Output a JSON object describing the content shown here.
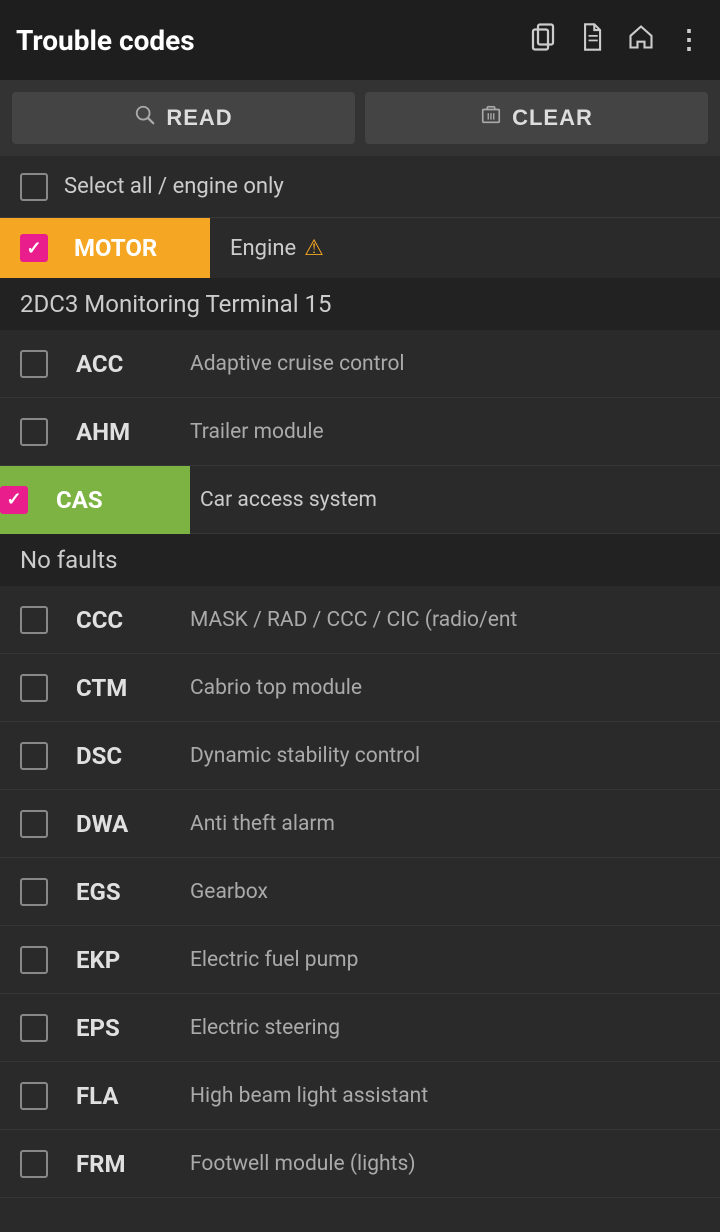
{
  "header": {
    "title": "Trouble codes",
    "icons": [
      "copy",
      "document",
      "home",
      "more"
    ]
  },
  "toolbar": {
    "read_label": "READ",
    "clear_label": "CLEAR"
  },
  "select_all": {
    "label": "Select all / engine only",
    "checked": false
  },
  "motor_module": {
    "badge": "MOTOR",
    "description": "Engine",
    "checked": true,
    "has_warning": true
  },
  "sub_header": "2DC3 Monitoring Terminal 15",
  "items": [
    {
      "code": "ACC",
      "desc": "Adaptive cruise control",
      "checked": false,
      "highlighted": false
    },
    {
      "code": "AHM",
      "desc": "Trailer module",
      "checked": false,
      "highlighted": false
    },
    {
      "code": "CAS",
      "desc": "Car access system",
      "checked": true,
      "highlighted": true
    },
    {
      "no_faults": "No faults"
    },
    {
      "code": "CCC",
      "desc": "MASK / RAD / CCC / CIC (radio/ent",
      "checked": false,
      "highlighted": false
    },
    {
      "code": "CTM",
      "desc": "Cabrio top module",
      "checked": false,
      "highlighted": false
    },
    {
      "code": "DSC",
      "desc": "Dynamic stability control",
      "checked": false,
      "highlighted": false
    },
    {
      "code": "DWA",
      "desc": "Anti theft alarm",
      "checked": false,
      "highlighted": false
    },
    {
      "code": "EGS",
      "desc": "Gearbox",
      "checked": false,
      "highlighted": false
    },
    {
      "code": "EKP",
      "desc": "Electric fuel pump",
      "checked": false,
      "highlighted": false
    },
    {
      "code": "EPS",
      "desc": "Electric steering",
      "checked": false,
      "highlighted": false
    },
    {
      "code": "FLA",
      "desc": "High beam light assistant",
      "checked": false,
      "highlighted": false
    },
    {
      "code": "FRM",
      "desc": "Footwell module (lights)",
      "checked": false,
      "highlighted": false
    }
  ]
}
